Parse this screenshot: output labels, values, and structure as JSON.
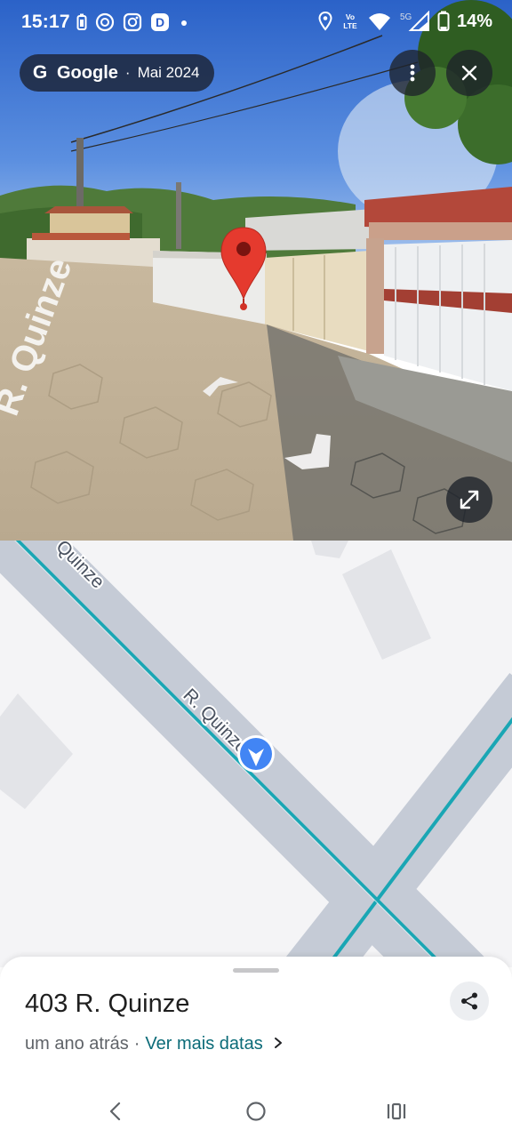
{
  "status_bar": {
    "time": "15:17",
    "left_icons": [
      "battery-saver-icon",
      "circle-app-icon",
      "instagram-icon",
      "app-d-icon",
      "dot-icon"
    ],
    "right_icons": [
      "location-icon",
      "volte-icon",
      "wifi-icon",
      "5g-icon",
      "signal-icon",
      "battery-icon"
    ],
    "volte_label": "Vo\nLTE",
    "network_label": "5G",
    "battery": "14%"
  },
  "street_view": {
    "provider_letter": "G",
    "provider": "Google",
    "separator": "·",
    "capture_date": "Mai 2024",
    "street_sign": "R. Quinze",
    "buttons": [
      "more-options-icon",
      "close-icon",
      "expand-icon"
    ]
  },
  "map": {
    "street_label_top": "Quinze",
    "street_label_mid": "R. Quinze",
    "road_color": "#c5cbd6",
    "route_line_color": "#1aa6b4",
    "marker_color": "#4285f4"
  },
  "place": {
    "address": "403 R. Quinze",
    "age": "um ano atrás",
    "separator": "·",
    "more_dates_link": "Ver mais datas",
    "link_color": "#0b6b78"
  },
  "nav_bar": {
    "icons": [
      "back-icon",
      "home-icon",
      "recents-icon"
    ]
  }
}
